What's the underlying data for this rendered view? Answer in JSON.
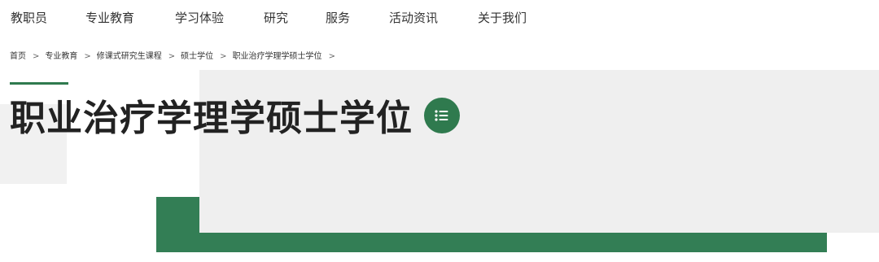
{
  "nav": {
    "items": [
      {
        "label": "教职员"
      },
      {
        "label": "专业教育"
      },
      {
        "label": "学习体验"
      },
      {
        "label": "研究"
      },
      {
        "label": "服务"
      },
      {
        "label": "活动资讯"
      },
      {
        "label": "关于我们"
      }
    ]
  },
  "breadcrumb": {
    "items": [
      {
        "label": "首页"
      },
      {
        "label": "专业教育"
      },
      {
        "label": "修课式研究生课程"
      },
      {
        "label": "硕士学位"
      },
      {
        "label": "职业治疗学理学硕士学位"
      }
    ]
  },
  "title": {
    "text": "职业治疗学理学硕士学位",
    "menu_icon": "list-menu-icon"
  },
  "colors": {
    "accent": "#2f7a4e",
    "panel": "#efefef"
  }
}
